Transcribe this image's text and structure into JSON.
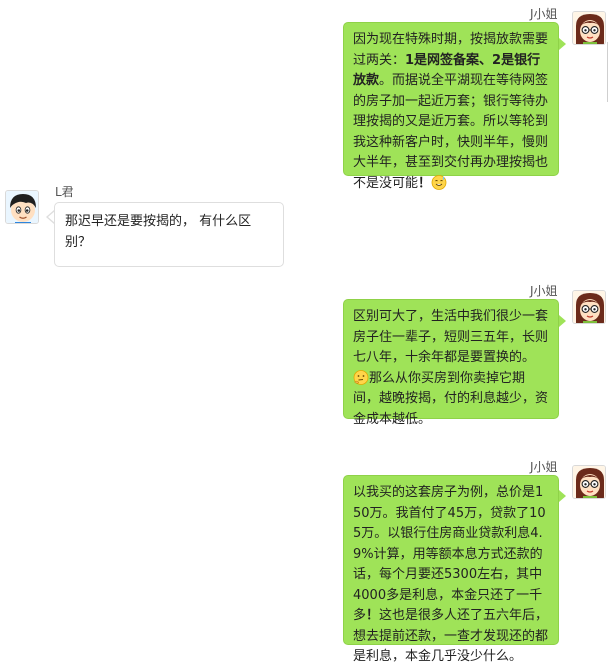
{
  "messages": [
    {
      "sender": "J小姐",
      "side": "right",
      "avatar": "girl-with-glasses-avatar",
      "parts": [
        {
          "t": "因为现在特殊时期，按揭放款需要过两关："
        },
        {
          "t": "1是网签备案、2是银行放款",
          "bold": true
        },
        {
          "t": "。而据说全平湖现在等待网签的房子加一起近万套；银行等待办理按揭的又是近万套。所以等轮到我这种新客户时，快则半年，慢则大半年，甚至到交付再办理按揭也不是没可能"
        },
        {
          "t": "！",
          "bold": true
        },
        {
          "emoji": "sweat-smile-emoji"
        }
      ]
    },
    {
      "sender": "L君",
      "side": "left",
      "avatar": "boy-avatar",
      "parts": [
        {
          "t": "那迟早还是要按揭的， 有什么区别？"
        }
      ]
    },
    {
      "sender": "J小姐",
      "side": "right",
      "avatar": "girl-with-glasses-avatar",
      "parts": [
        {
          "t": "区别可大了，生活中我们很少一套房子住一辈子，短则三五年，长则七八年，十余年都是要置换的。"
        },
        {
          "emoji": "thinking-emoji"
        },
        {
          "t": "那么从你买房到你卖掉它期间，越晚按揭，付的利息越少，资金成本越低。"
        }
      ]
    },
    {
      "sender": "J小姐",
      "side": "right",
      "avatar": "girl-with-glasses-avatar",
      "parts": [
        {
          "t": "以我买的这套房子为例，总价是150万。我首付了45万，贷款了105万。以银行住房商业贷款利息4.9%计算，用等额本息方式还款的话，每个月要还5300左右，其中4000多是利息，本金只还了一千多"
        },
        {
          "t": "！",
          "bold": true
        },
        {
          "t": "这也是很多人还了五六年后，想去提前还款，一查才发现还的都是利息，本金几乎没少什么。"
        }
      ]
    }
  ]
}
